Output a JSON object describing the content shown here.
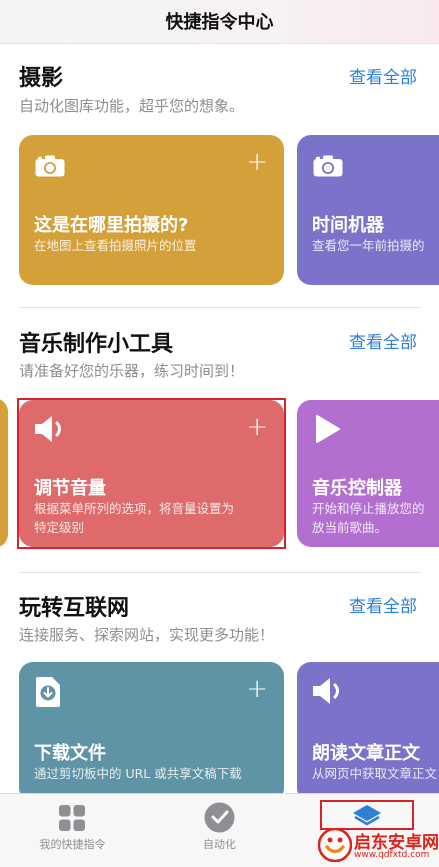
{
  "header": {
    "title": "快捷指令中心"
  },
  "sections": [
    {
      "title": "摄影",
      "link": "查看全部",
      "subtitle": "自动化图库功能，超乎您的想象。",
      "cards": [
        {
          "title": "这是在哪里拍摄的?",
          "desc": "在地图上查看拍摄照片的位置",
          "icon": "camera-icon",
          "color": "#d4a03a",
          "addable": true
        },
        {
          "title": "时间机器",
          "desc": "查看您一年前拍摄的",
          "icon": "camera-icon",
          "color": "#7b72c9",
          "addable": false
        }
      ]
    },
    {
      "title": "音乐制作小工具",
      "link": "查看全部",
      "subtitle": "请准备好您的乐器，练习时间到！",
      "cards": [
        {
          "title": "调节音量",
          "desc1": "根据菜单所列的选项，将音量设置为",
          "desc2": "特定级别",
          "icon": "speaker-icon",
          "color": "#de6a6c",
          "addable": true
        },
        {
          "title": "音乐控制器",
          "desc1": "开始和停止播放您的",
          "desc2": "放当前歌曲。",
          "icon": "play-icon",
          "color": "#b26fd0",
          "addable": false
        }
      ]
    },
    {
      "title": "玩转互联网",
      "link": "查看全部",
      "subtitle": "连接服务、探索网站，实现更多功能！",
      "cards": [
        {
          "title": "下载文件",
          "desc": "通过剪切板中的 URL 或共享文稿下载",
          "icon": "file-download-icon",
          "color": "#5f93a6",
          "addable": true
        },
        {
          "title": "朗读文章正文",
          "desc": "从网页中获取文章正文",
          "icon": "speaker-icon",
          "color": "#7b72c9",
          "addable": false
        }
      ]
    }
  ],
  "tabbar": {
    "items": [
      {
        "label": "我的快捷指令",
        "icon": "grid-icon"
      },
      {
        "label": "自动化",
        "icon": "check-circle-icon"
      },
      {
        "label": "",
        "icon": "layers-icon"
      }
    ]
  },
  "watermark": {
    "text": "启东安卓网",
    "url": "www.qdfxtd.com"
  },
  "colors": {
    "accent": "#2f7ed8",
    "highlight": "#d8232a"
  }
}
